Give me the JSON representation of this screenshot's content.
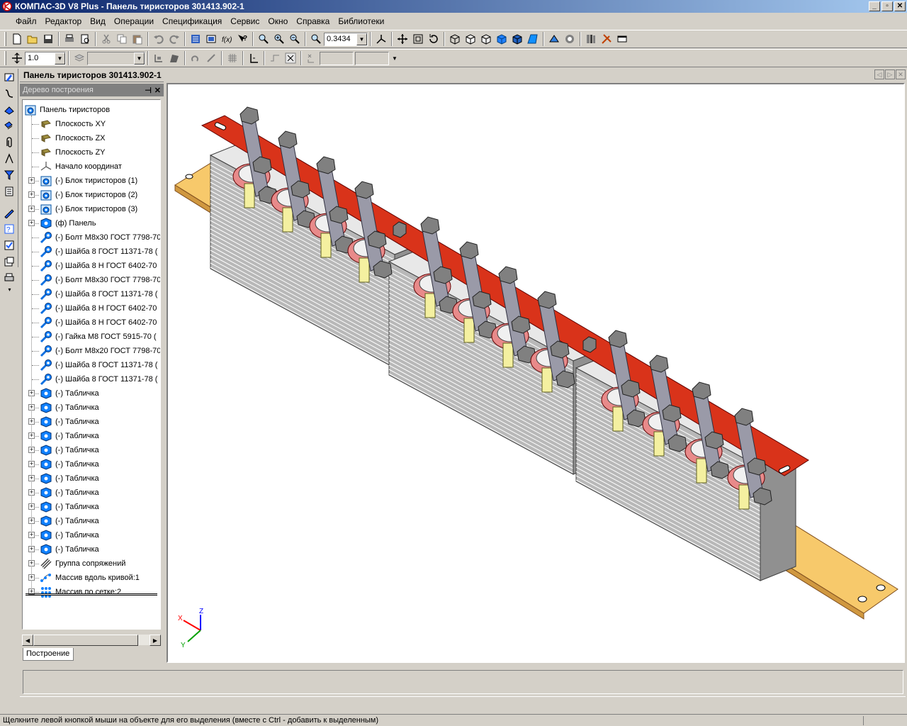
{
  "window": {
    "title": "КОМПАС-3D V8 Plus - Панель тиристоров 301413.902-1",
    "buttons": [
      "_",
      "▫",
      "✕"
    ]
  },
  "menu": [
    "Файл",
    "Редактор",
    "Вид",
    "Операции",
    "Спецификация",
    "Сервис",
    "Окно",
    "Справка",
    "Библиотеки"
  ],
  "toolbar": {
    "zoom_value": "0.3434",
    "step_value": "1.0"
  },
  "panel": {
    "title": "Панель тиристоров 301413.902-1",
    "tree_caption": "Дерево построения",
    "tab_label": "Построение"
  },
  "tree": {
    "root": "Панель тиристоров",
    "items": [
      {
        "label": "Плоскость XY",
        "icon": "plane-icon",
        "expandable": false
      },
      {
        "label": "Плоскость ZX",
        "icon": "plane-icon",
        "expandable": false
      },
      {
        "label": "Плоскость ZY",
        "icon": "plane-icon",
        "expandable": false
      },
      {
        "label": "Начало координат",
        "icon": "origin-icon",
        "expandable": false
      },
      {
        "label": "(-) Блок тиристоров (1)",
        "icon": "assembly-icon",
        "expandable": true
      },
      {
        "label": "(-) Блок тиристоров (2)",
        "icon": "assembly-icon",
        "expandable": true
      },
      {
        "label": "(-) Блок тиристоров (3)",
        "icon": "assembly-icon",
        "expandable": true
      },
      {
        "label": "(ф) Панель",
        "icon": "part-icon",
        "expandable": true
      },
      {
        "label": "(-) Болт М8х30 ГОСТ 7798-70",
        "icon": "standard-part-icon",
        "expandable": false
      },
      {
        "label": "(-) Шайба 8 ГОСТ 11371-78 (",
        "icon": "standard-part-icon",
        "expandable": false
      },
      {
        "label": "(-) Шайба 8 Н ГОСТ 6402-70",
        "icon": "standard-part-icon",
        "expandable": false
      },
      {
        "label": "(-) Болт М8х30 ГОСТ 7798-70",
        "icon": "standard-part-icon",
        "expandable": false
      },
      {
        "label": "(-) Шайба 8 ГОСТ 11371-78 (",
        "icon": "standard-part-icon",
        "expandable": false
      },
      {
        "label": "(-) Шайба 8 Н ГОСТ 6402-70",
        "icon": "standard-part-icon",
        "expandable": false
      },
      {
        "label": "(-) Шайба 8 Н ГОСТ 6402-70",
        "icon": "standard-part-icon",
        "expandable": false
      },
      {
        "label": "(-) Гайка М8 ГОСТ 5915-70 (",
        "icon": "standard-part-icon",
        "expandable": false
      },
      {
        "label": "(-) Болт М8х20 ГОСТ 7798-70",
        "icon": "standard-part-icon",
        "expandable": false
      },
      {
        "label": "(-) Шайба 8 ГОСТ 11371-78 (",
        "icon": "standard-part-icon",
        "expandable": false
      },
      {
        "label": "(-) Шайба 8 ГОСТ 11371-78 (",
        "icon": "standard-part-icon",
        "expandable": false
      },
      {
        "label": "(-) Табличка",
        "icon": "part-icon",
        "expandable": true
      },
      {
        "label": "(-) Табличка",
        "icon": "part-icon",
        "expandable": true
      },
      {
        "label": "(-) Табличка",
        "icon": "part-icon",
        "expandable": true
      },
      {
        "label": "(-) Табличка",
        "icon": "part-icon",
        "expandable": true
      },
      {
        "label": "(-) Табличка",
        "icon": "part-icon",
        "expandable": true
      },
      {
        "label": "(-) Табличка",
        "icon": "part-icon",
        "expandable": true
      },
      {
        "label": "(-) Табличка",
        "icon": "part-icon",
        "expandable": true
      },
      {
        "label": "(-) Табличка",
        "icon": "part-icon",
        "expandable": true
      },
      {
        "label": "(-) Табличка",
        "icon": "part-icon",
        "expandable": true
      },
      {
        "label": "(-) Табличка",
        "icon": "part-icon",
        "expandable": true
      },
      {
        "label": "(-) Табличка",
        "icon": "part-icon",
        "expandable": true
      },
      {
        "label": "(-) Табличка",
        "icon": "part-icon",
        "expandable": true
      },
      {
        "label": "Группа сопряжений",
        "icon": "mates-icon",
        "expandable": true
      },
      {
        "label": "Массив вдоль кривой:1",
        "icon": "curve-array-icon",
        "expandable": true
      },
      {
        "label": "Массив по сетке:2",
        "icon": "grid-array-icon",
        "expandable": true
      }
    ]
  },
  "axes": {
    "x": "X",
    "y": "Y",
    "z": "Z"
  },
  "status": {
    "hint": "Щелкните левой кнопкой мыши на объекте для его выделения (вместе с Ctrl - добавить к выделенным)"
  },
  "colors": {
    "titlebar_start": "#0a246a",
    "busbar": "#d9331a",
    "base_plate": "#f7c96b",
    "heatsink": "#b8b8b8",
    "bracket": "#9a9aa8",
    "stud": "#f4f0a0",
    "insulator": "#e88a8a"
  }
}
